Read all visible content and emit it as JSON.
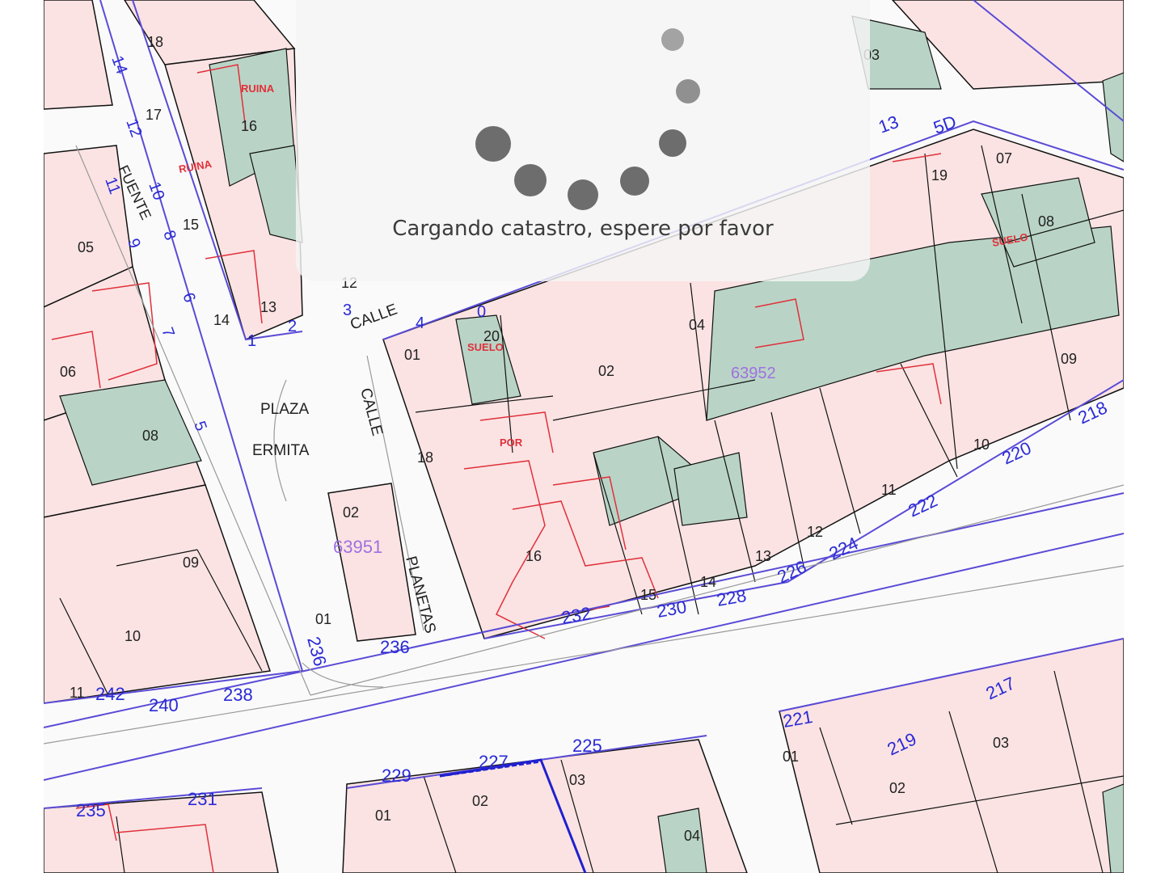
{
  "loading": {
    "message": "Cargando catastro, espere por favor"
  },
  "map": {
    "streets": [
      {
        "id": "plaza",
        "text": "PLAZA"
      },
      {
        "id": "ermita",
        "text": "ERMITA"
      },
      {
        "id": "calle-vertical",
        "text": "CALLE"
      },
      {
        "id": "calle-top",
        "text": "CALLE"
      },
      {
        "id": "fuente",
        "text": "FUENTE"
      },
      {
        "id": "planetas",
        "text": "PLANETAS"
      }
    ],
    "references": [
      {
        "id": "ref-63951",
        "text": "63951"
      },
      {
        "id": "ref-63952",
        "text": "63952"
      }
    ],
    "parcels": [
      {
        "id": "p-01a",
        "text": "01"
      },
      {
        "id": "p-02a",
        "text": "02"
      },
      {
        "id": "p-04a",
        "text": "04"
      },
      {
        "id": "p-09a",
        "text": "09"
      },
      {
        "id": "p-10a",
        "text": "10"
      },
      {
        "id": "p-11a",
        "text": "11"
      },
      {
        "id": "p-12a",
        "text": "12"
      },
      {
        "id": "p-13a",
        "text": "13"
      },
      {
        "id": "p-14a",
        "text": "14"
      },
      {
        "id": "p-15a",
        "text": "15"
      },
      {
        "id": "p-16a",
        "text": "16"
      },
      {
        "id": "p-18a",
        "text": "18"
      },
      {
        "id": "p-20a",
        "text": "20"
      },
      {
        "id": "p-19",
        "text": "19"
      },
      {
        "id": "p-07",
        "text": "07"
      },
      {
        "id": "p-08b",
        "text": "08"
      },
      {
        "id": "p-05",
        "text": "05"
      },
      {
        "id": "p-06",
        "text": "06"
      },
      {
        "id": "p-08",
        "text": "08"
      },
      {
        "id": "p-09",
        "text": "09"
      },
      {
        "id": "p-10",
        "text": "10"
      },
      {
        "id": "p-11",
        "text": "11"
      },
      {
        "id": "p-02-plaza",
        "text": "02"
      },
      {
        "id": "p-01-plaza",
        "text": "01"
      },
      {
        "id": "p-18",
        "text": "18"
      },
      {
        "id": "p-17",
        "text": "17"
      },
      {
        "id": "p-16",
        "text": "16"
      },
      {
        "id": "p-15",
        "text": "15"
      },
      {
        "id": "p-14",
        "text": "14"
      },
      {
        "id": "p-13",
        "text": "13"
      },
      {
        "id": "p-12",
        "text": "12"
      },
      {
        "id": "p-03",
        "text": "03"
      },
      {
        "id": "p-01b",
        "text": "01"
      },
      {
        "id": "p-02b",
        "text": "02"
      },
      {
        "id": "p-03b",
        "text": "03"
      },
      {
        "id": "p-04b",
        "text": "04"
      },
      {
        "id": "p-01c",
        "text": "01"
      },
      {
        "id": "p-02c",
        "text": "02"
      },
      {
        "id": "p-03c",
        "text": "03"
      }
    ],
    "numbers": [
      {
        "id": "n-218",
        "text": "218"
      },
      {
        "id": "n-220",
        "text": "220"
      },
      {
        "id": "n-222",
        "text": "222"
      },
      {
        "id": "n-224",
        "text": "224"
      },
      {
        "id": "n-226",
        "text": "226"
      },
      {
        "id": "n-228",
        "text": "228"
      },
      {
        "id": "n-230",
        "text": "230"
      },
      {
        "id": "n-232",
        "text": "232"
      },
      {
        "id": "n-236a",
        "text": "236"
      },
      {
        "id": "n-236b",
        "text": "236"
      },
      {
        "id": "n-238",
        "text": "238"
      },
      {
        "id": "n-240",
        "text": "240"
      },
      {
        "id": "n-242",
        "text": "242"
      },
      {
        "id": "n-217",
        "text": "217"
      },
      {
        "id": "n-219",
        "text": "219"
      },
      {
        "id": "n-221",
        "text": "221"
      },
      {
        "id": "n-225",
        "text": "225"
      },
      {
        "id": "n-227",
        "text": "227"
      },
      {
        "id": "n-229",
        "text": "229"
      },
      {
        "id": "n-231",
        "text": "231"
      },
      {
        "id": "n-235",
        "text": "235"
      },
      {
        "id": "n-13",
        "text": "13"
      },
      {
        "id": "n-5d",
        "text": "5D"
      },
      {
        "id": "n-0",
        "text": "0"
      },
      {
        "id": "n-4",
        "text": "4"
      },
      {
        "id": "n-2",
        "text": "2"
      },
      {
        "id": "n-3",
        "text": "3"
      },
      {
        "id": "n-1",
        "text": "1"
      },
      {
        "id": "n-5",
        "text": "5"
      },
      {
        "id": "n-6",
        "text": "6"
      },
      {
        "id": "n-7",
        "text": "7"
      },
      {
        "id": "n-8",
        "text": "8"
      },
      {
        "id": "n-9",
        "text": "9"
      },
      {
        "id": "n-10",
        "text": "10"
      },
      {
        "id": "n-11",
        "text": "11"
      },
      {
        "id": "n-12",
        "text": "12"
      },
      {
        "id": "n-14",
        "text": "14"
      }
    ],
    "uses": [
      {
        "id": "u-ruina1",
        "text": "RUINA"
      },
      {
        "id": "u-ruina2",
        "text": "RUINA"
      },
      {
        "id": "u-suelo1",
        "text": "SUELO"
      },
      {
        "id": "u-suelo2",
        "text": "SUELO"
      },
      {
        "id": "u-por",
        "text": "POR"
      }
    ]
  },
  "colors": {
    "parcel_fill": "#fbe3e3",
    "garden_fill": "#b9d4c6",
    "boundary_blue": "#5a4bd6",
    "parcel_line": "#111111",
    "building_red": "#e0303a",
    "number_blue": "#2a2ad6",
    "label_red": "#e0303a",
    "ref_purple": "#a070e0",
    "spinner": "#6d6d6d"
  }
}
